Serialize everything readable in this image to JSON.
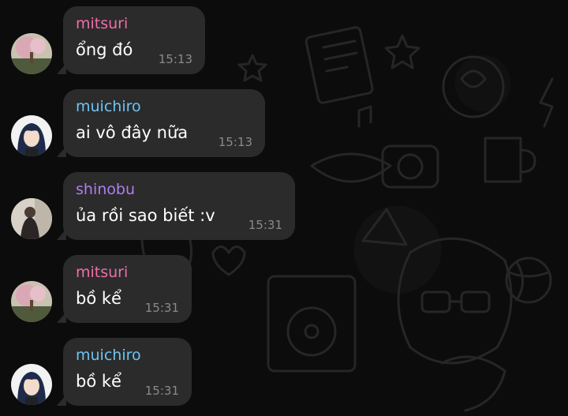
{
  "colors": {
    "background": "#0c0c0c",
    "bubble": "#2b2b2b",
    "text": "#ffffff",
    "timestamp": "#8a8a8a",
    "sender_pink": "#f06ea9",
    "sender_blue": "#6ec3f4",
    "sender_purple": "#b07cf2"
  },
  "messages": [
    {
      "sender": "mitsuri",
      "text": "ổng đó",
      "time": "15:13",
      "sender_color": "#f06ea9",
      "avatar": "mitsuri-avatar-icon"
    },
    {
      "sender": "muichiro",
      "text": "ai vô đây nữa",
      "time": "15:13",
      "sender_color": "#6ec3f4",
      "avatar": "muichiro-avatar-icon"
    },
    {
      "sender": "shinobu",
      "text": "ủa rồi sao biết :v",
      "time": "15:31",
      "sender_color": "#b07cf2",
      "avatar": "shinobu-avatar-icon"
    },
    {
      "sender": "mitsuri",
      "text": "bồ kể",
      "time": "15:31",
      "sender_color": "#f06ea9",
      "avatar": "mitsuri-avatar-icon"
    },
    {
      "sender": "muichiro",
      "text": "bồ kể",
      "time": "15:31",
      "sender_color": "#6ec3f4",
      "avatar": "muichiro-avatar-icon"
    }
  ]
}
